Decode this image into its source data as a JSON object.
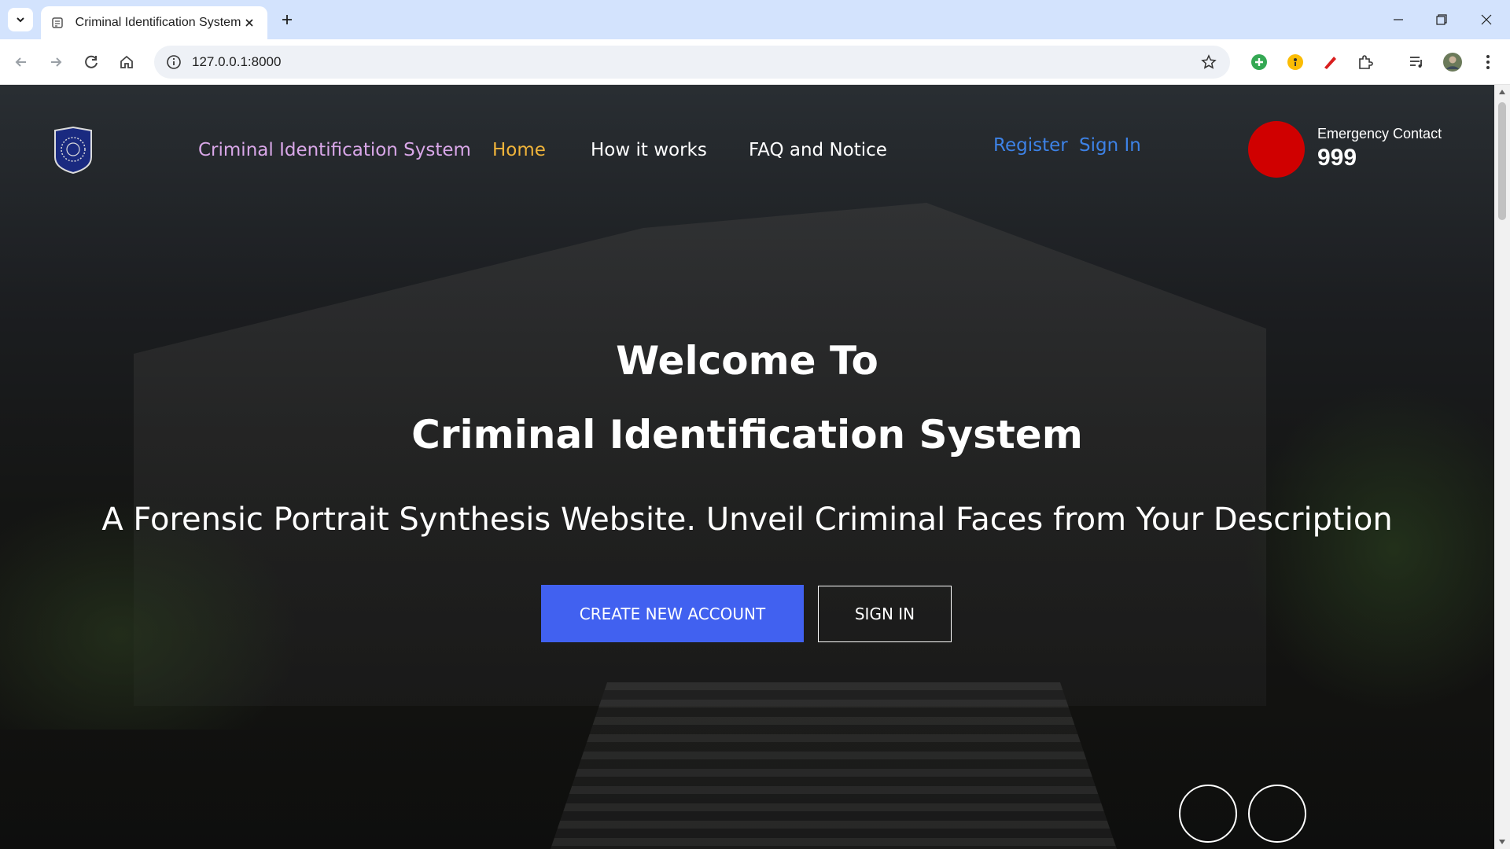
{
  "browser": {
    "tab_title": "Criminal Identification System",
    "url": "127.0.0.1:8000"
  },
  "header": {
    "brand": "Criminal Identification System",
    "nav": {
      "home": "Home",
      "how_it_works": "How it works",
      "faq": "FAQ and Notice"
    },
    "auth": {
      "register": "Register",
      "sign_in": "Sign In"
    },
    "emergency": {
      "label": "Emergency Contact",
      "number": "999"
    }
  },
  "hero": {
    "title_line1": "Welcome To",
    "title_line2": "Criminal Identification System",
    "subtitle": "A Forensic Portrait Synthesis Website. Unveil Criminal Faces from Your Description",
    "create_button": "CREATE NEW ACCOUNT",
    "signin_button": "SIGN IN"
  },
  "colors": {
    "nav_active": "#f0b43a",
    "brand": "#d9a7e8",
    "auth_link": "#3d82e6",
    "primary_button": "#4161f0",
    "emergency": "#d00000"
  }
}
